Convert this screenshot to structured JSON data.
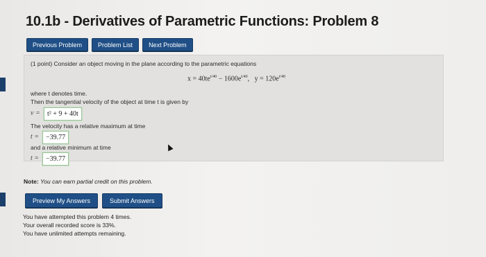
{
  "page": {
    "title": "10.1b - Derivatives of Parametric Functions: Problem 8"
  },
  "nav": {
    "previous": "Previous Problem",
    "list": "Problem List",
    "next": "Next Problem"
  },
  "problem": {
    "intro": "(1 point) Consider an object moving in the plane according to the parametric equations",
    "eq_x": "x = 40te",
    "eq_x_exp": "t/40",
    "eq_x2": "− 1600e",
    "eq_x2_exp": "t/40",
    "eq_y": "y = 120e",
    "eq_y_exp": "t/40",
    "where_t": "where t denotes time.",
    "velocity_text": "Then the tangential velocity of the object at time t is given by",
    "v_label": "v =",
    "v_answer": "t² + 9 + 40t",
    "max_text": "The velocity has a relative maximum at time",
    "t_label_1": "t =",
    "max_answer": "−39.77",
    "min_text": "and a relative minimum at time",
    "t_label_2": "t =",
    "min_answer": "−39.77"
  },
  "note": {
    "bold": "Note:",
    "italic": "You can earn partial credit on this problem."
  },
  "actions": {
    "preview": "Preview My Answers",
    "submit": "Submit Answers"
  },
  "status": {
    "line1": "You have attempted this problem 4 times.",
    "line2": "Your overall recorded score is 33%.",
    "line3": "You have unlimited attempts remaining."
  },
  "colors": {
    "button": "#1f4f86",
    "answer_border": "#9cc39a"
  }
}
